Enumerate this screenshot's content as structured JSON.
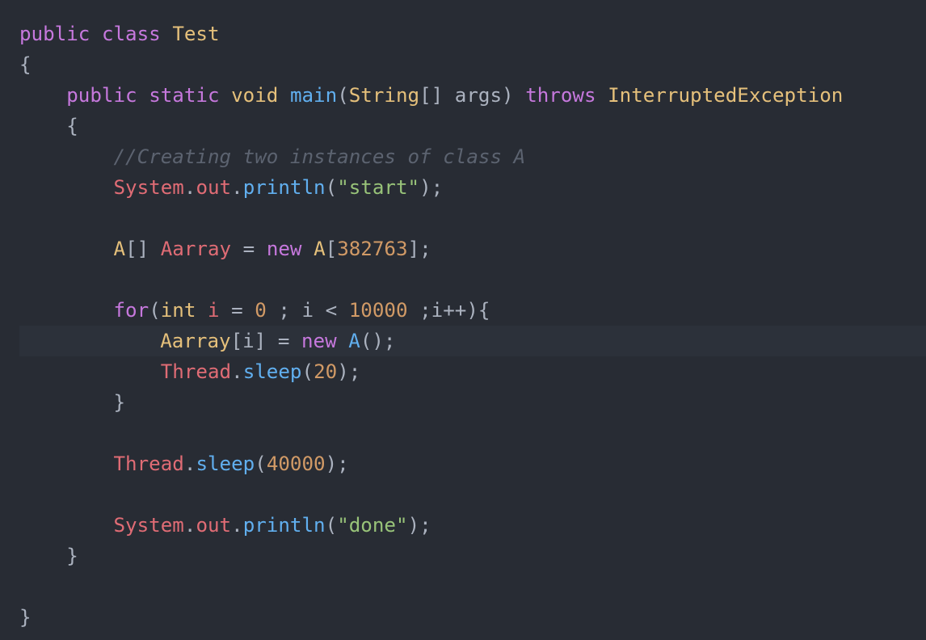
{
  "editor": {
    "lines": [
      [
        {
          "text": "public",
          "t": "kw"
        },
        {
          "text": " ",
          "t": "pl"
        },
        {
          "text": "class",
          "t": "kw"
        },
        {
          "text": " ",
          "t": "pl"
        },
        {
          "text": "Test",
          "t": "cls"
        }
      ],
      [
        {
          "text": "{",
          "t": "pl"
        }
      ],
      [
        {
          "text": "    ",
          "t": "pl"
        },
        {
          "text": "public",
          "t": "kw"
        },
        {
          "text": " ",
          "t": "pl"
        },
        {
          "text": "static",
          "t": "kw"
        },
        {
          "text": " ",
          "t": "pl"
        },
        {
          "text": "void",
          "t": "cls"
        },
        {
          "text": " ",
          "t": "pl"
        },
        {
          "text": "main",
          "t": "fn"
        },
        {
          "text": "(",
          "t": "pl"
        },
        {
          "text": "String",
          "t": "cls"
        },
        {
          "text": "[] args) ",
          "t": "pl"
        },
        {
          "text": "throws",
          "t": "kw"
        },
        {
          "text": " ",
          "t": "pl"
        },
        {
          "text": "InterruptedException",
          "t": "cls"
        }
      ],
      [
        {
          "text": "    {",
          "t": "pl"
        }
      ],
      [
        {
          "text": "        ",
          "t": "pl"
        },
        {
          "text": "//Creating two instances of class A",
          "t": "cmt"
        }
      ],
      [
        {
          "text": "        ",
          "t": "pl"
        },
        {
          "text": "System",
          "t": "obj"
        },
        {
          "text": ".",
          "t": "pl"
        },
        {
          "text": "out",
          "t": "obj"
        },
        {
          "text": ".",
          "t": "pl"
        },
        {
          "text": "println",
          "t": "fn"
        },
        {
          "text": "(",
          "t": "pl"
        },
        {
          "text": "\"start\"",
          "t": "str"
        },
        {
          "text": ");",
          "t": "pl"
        }
      ],
      [],
      [
        {
          "text": "        ",
          "t": "pl"
        },
        {
          "text": "A",
          "t": "cls"
        },
        {
          "text": "[] ",
          "t": "pl"
        },
        {
          "text": "Aarray",
          "t": "obj"
        },
        {
          "text": " = ",
          "t": "pl"
        },
        {
          "text": "new",
          "t": "kw"
        },
        {
          "text": " ",
          "t": "pl"
        },
        {
          "text": "A",
          "t": "cls"
        },
        {
          "text": "[",
          "t": "pl"
        },
        {
          "text": "382763",
          "t": "num"
        },
        {
          "text": "];",
          "t": "pl"
        }
      ],
      [],
      [
        {
          "text": "        ",
          "t": "pl"
        },
        {
          "text": "for",
          "t": "kw"
        },
        {
          "text": "(",
          "t": "pl"
        },
        {
          "text": "int",
          "t": "cls"
        },
        {
          "text": " ",
          "t": "pl"
        },
        {
          "text": "i",
          "t": "obj"
        },
        {
          "text": " = ",
          "t": "pl"
        },
        {
          "text": "0",
          "t": "num"
        },
        {
          "text": " ; i < ",
          "t": "pl"
        },
        {
          "text": "10000",
          "t": "num"
        },
        {
          "text": " ;i++){",
          "t": "pl"
        }
      ],
      [
        {
          "text": "    ",
          "t": "pl"
        },
        {
          "text": "Aarray",
          "t": "cls"
        },
        {
          "text": "[i] = ",
          "t": "pl"
        },
        {
          "text": "new",
          "t": "kw"
        },
        {
          "text": " ",
          "t": "pl"
        },
        {
          "text": "A",
          "t": "fn"
        },
        {
          "text": "();",
          "t": "pl"
        }
      ],
      [
        {
          "text": "            ",
          "t": "pl"
        },
        {
          "text": "Thread",
          "t": "obj"
        },
        {
          "text": ".",
          "t": "pl"
        },
        {
          "text": "sleep",
          "t": "fn"
        },
        {
          "text": "(",
          "t": "pl"
        },
        {
          "text": "20",
          "t": "num"
        },
        {
          "text": ");",
          "t": "pl"
        }
      ],
      [
        {
          "text": "        }",
          "t": "pl"
        }
      ],
      [],
      [
        {
          "text": "        ",
          "t": "pl"
        },
        {
          "text": "Thread",
          "t": "obj"
        },
        {
          "text": ".",
          "t": "pl"
        },
        {
          "text": "sleep",
          "t": "fn"
        },
        {
          "text": "(",
          "t": "pl"
        },
        {
          "text": "40000",
          "t": "num"
        },
        {
          "text": ");",
          "t": "pl"
        }
      ],
      [],
      [
        {
          "text": "        ",
          "t": "pl"
        },
        {
          "text": "System",
          "t": "obj"
        },
        {
          "text": ".",
          "t": "pl"
        },
        {
          "text": "out",
          "t": "obj"
        },
        {
          "text": ".",
          "t": "pl"
        },
        {
          "text": "println",
          "t": "fn"
        },
        {
          "text": "(",
          "t": "pl"
        },
        {
          "text": "\"done\"",
          "t": "str"
        },
        {
          "text": ");",
          "t": "pl"
        }
      ],
      [
        {
          "text": "    }",
          "t": "pl"
        }
      ],
      [],
      [
        {
          "text": "}",
          "t": "pl"
        }
      ]
    ]
  }
}
